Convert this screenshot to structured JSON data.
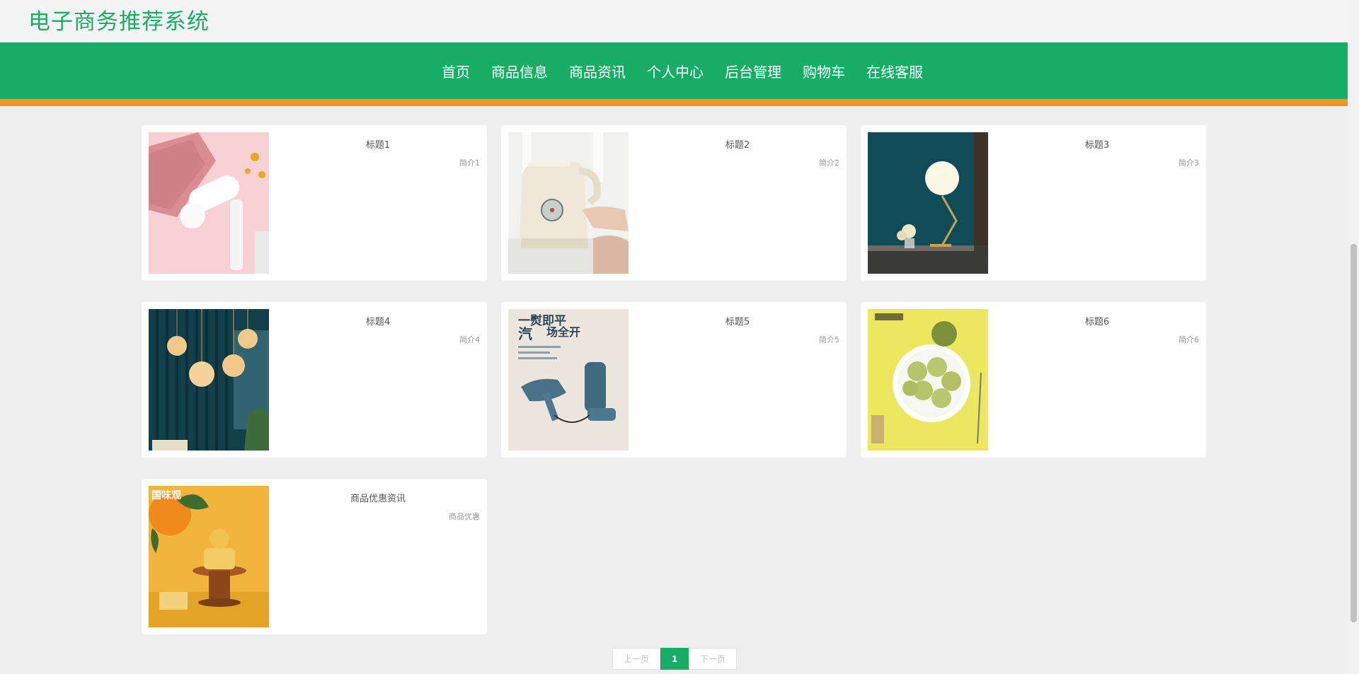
{
  "site": {
    "title": "电子商务推荐系统"
  },
  "nav": {
    "items": [
      {
        "label": "首页"
      },
      {
        "label": "商品信息"
      },
      {
        "label": "商品资讯"
      },
      {
        "label": "个人中心"
      },
      {
        "label": "后台管理"
      },
      {
        "label": "购物车"
      },
      {
        "label": "在线客服"
      }
    ]
  },
  "colors": {
    "brand": "#17ad67",
    "accent": "#f7931d",
    "background": "#eeeeee"
  },
  "news": [
    {
      "title": "标题1",
      "summary": "简介1",
      "image": "hair-dryer-photo"
    },
    {
      "title": "标题2",
      "summary": "简介2",
      "image": "kettle-photo"
    },
    {
      "title": "标题3",
      "summary": "简介3",
      "image": "desk-lamp-photo"
    },
    {
      "title": "标题4",
      "summary": "简介4",
      "image": "pendant-lamp-photo"
    },
    {
      "title": "标题5",
      "summary": "简介5",
      "image": "garment-steamer-photo",
      "image_text": [
        "一熨即平",
        "汽",
        "场全开"
      ]
    },
    {
      "title": "标题6",
      "summary": "简介6",
      "image": "matcha-cookies-photo"
    },
    {
      "title": "商品优惠资讯",
      "summary": "商品优惠",
      "image": "mooncake-photo"
    }
  ],
  "pagination": {
    "prev": "上一页",
    "current": "1",
    "next": "下一页"
  }
}
